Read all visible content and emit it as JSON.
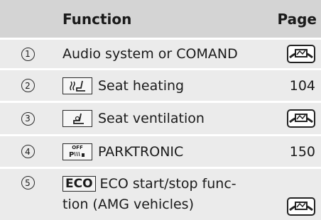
{
  "table": {
    "header": {
      "function": "Function",
      "page": "Page"
    },
    "rows": [
      {
        "num": "1",
        "icon": "none",
        "function": "Audio system or COMAND",
        "page": "",
        "page_icon": "steering-wheel-display-icon"
      },
      {
        "num": "2",
        "icon": "seat-heating-icon",
        "function": "Seat heating",
        "page": "104"
      },
      {
        "num": "3",
        "icon": "seat-ventilation-icon",
        "function": "Seat ventilation",
        "page": "",
        "page_icon": "steering-wheel-display-icon"
      },
      {
        "num": "4",
        "icon": "parktronic-off-icon",
        "icon_text": "OFF",
        "function": "PARKTRONIC",
        "page": "150"
      },
      {
        "num": "5",
        "icon": "eco-icon",
        "icon_text": "ECO",
        "function_line1": "ECO start/stop func-",
        "function_line2": "tion (AMG vehicles)",
        "page": "",
        "page_icon": "steering-wheel-display-icon"
      }
    ]
  }
}
